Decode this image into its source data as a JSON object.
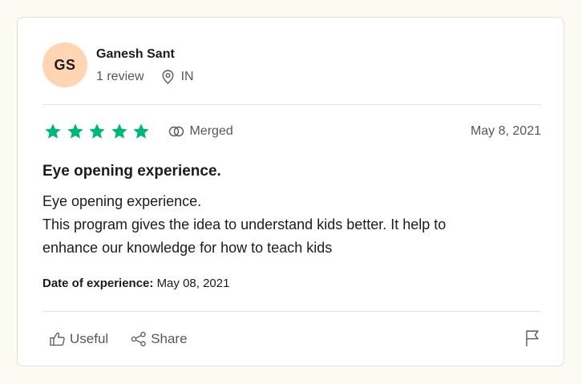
{
  "consumer": {
    "initials": "GS",
    "name": "Ganesh Sant",
    "review_count": "1 review",
    "country": "IN",
    "avatar_color": "#ffd5b4"
  },
  "review": {
    "stars": 5,
    "star_color": "#00b67a",
    "merged_label": "Merged",
    "date": "May 8, 2021",
    "title": "Eye opening experience.",
    "body_lines": [
      "Eye opening experience.",
      "This program gives the idea to understand kids better. It help to",
      "enhance our knowledge for how to teach kids"
    ],
    "experience_label": "Date of experience:",
    "experience_date": "May 08, 2021"
  },
  "actions": {
    "useful_label": "Useful",
    "share_label": "Share"
  },
  "icons": [
    "location-pin-icon",
    "merged-icon",
    "star-icon",
    "thumbs-up-icon",
    "share-icon",
    "flag-icon"
  ]
}
